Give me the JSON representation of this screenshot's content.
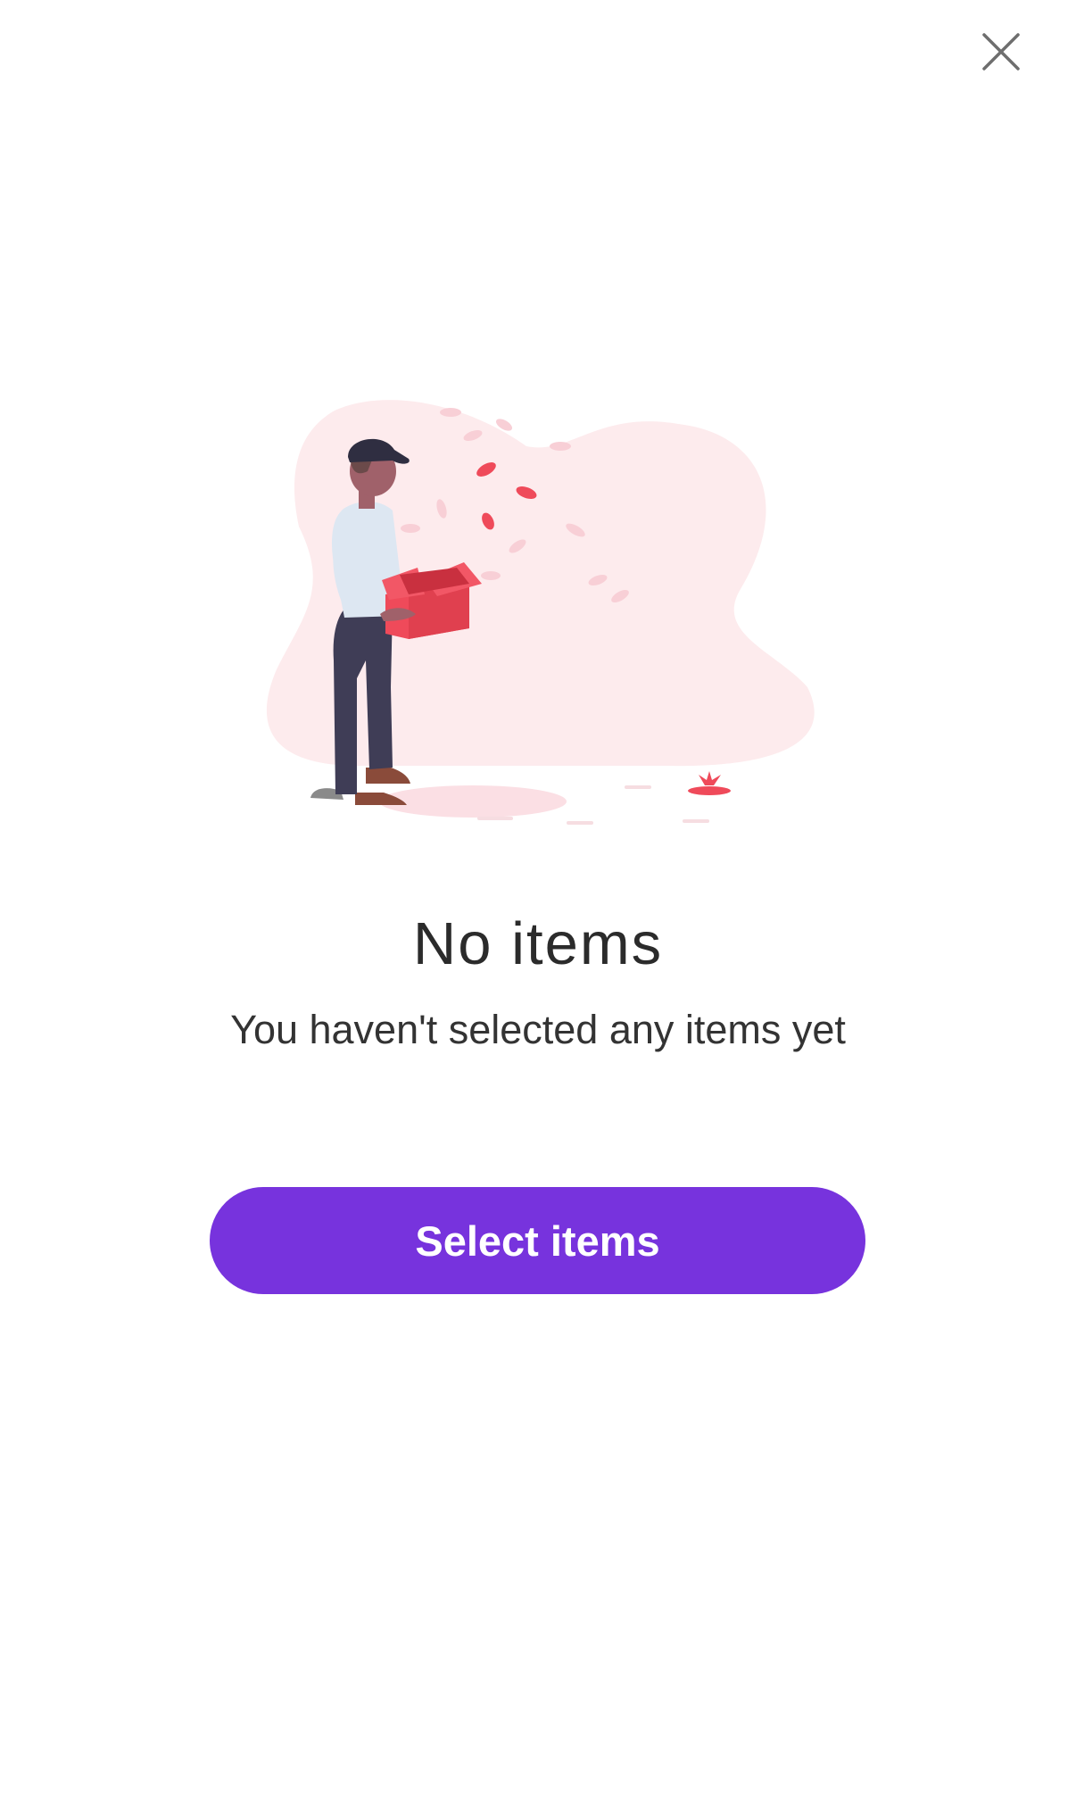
{
  "dialog": {
    "close_icon": "close-icon",
    "title": "No items",
    "subtitle": "You haven't selected any items yet",
    "select_button_label": "Select items"
  },
  "colors": {
    "accent": "#7733DD",
    "title_text": "#2B2B2B",
    "close_icon": "#6E6E6E",
    "illustration_blob": "#FDEBED",
    "box": "#EF4A5A"
  }
}
